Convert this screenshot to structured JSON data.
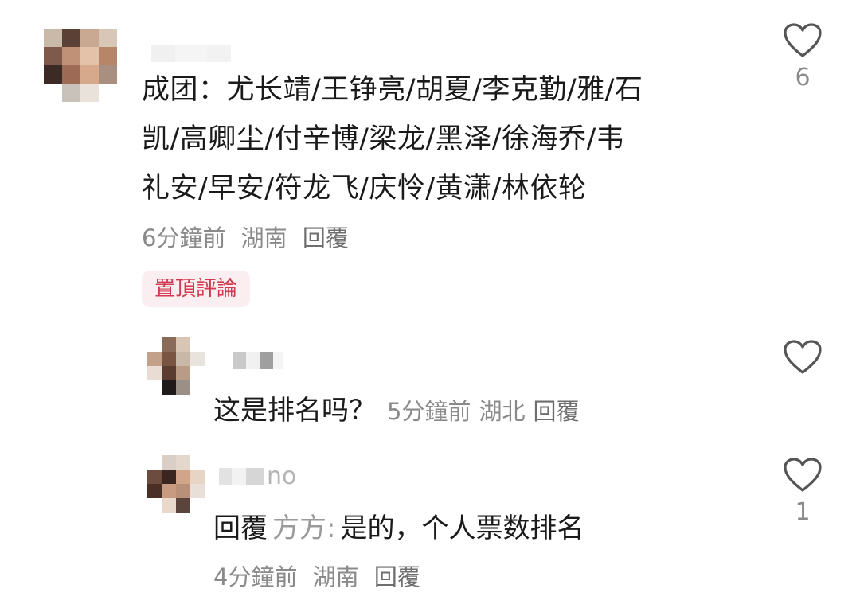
{
  "main_comment": {
    "text_lines": [
      "成团：尤长靖/王铮亮/胡夏/李克勤/雅/石",
      "凯/高卿尘/付辛博/梁龙/黑泽/徐海乔/韦",
      "礼安/早安/符龙飞/庆怜/黄潇/林依轮"
    ],
    "time": "6分鐘前",
    "location": "湖南",
    "reply_label": "回覆",
    "pinned_label": "置頂評論",
    "like_count": "6",
    "like_icon": "heart-outline-icon"
  },
  "replies": [
    {
      "username_suffix": "",
      "text": "这是排名吗？",
      "time": "5分鐘前",
      "location": "湖北",
      "reply_label": "回覆",
      "like_count": "",
      "like_icon": "heart-outline-icon"
    },
    {
      "username_suffix": "no",
      "reply_prefix": "回覆",
      "reply_to": "方方:",
      "text": "是的，个人票数排名",
      "time": "4分鐘前",
      "location": "湖南",
      "reply_label": "回覆",
      "like_count": "1",
      "like_icon": "heart-outline-icon"
    }
  ],
  "colors": {
    "text_primary": "#1a1a1a",
    "text_meta": "#8a8a8a",
    "pinned_text": "#d03a52",
    "pinned_bg": "#fbeef0",
    "heart_stroke": "#555555"
  }
}
